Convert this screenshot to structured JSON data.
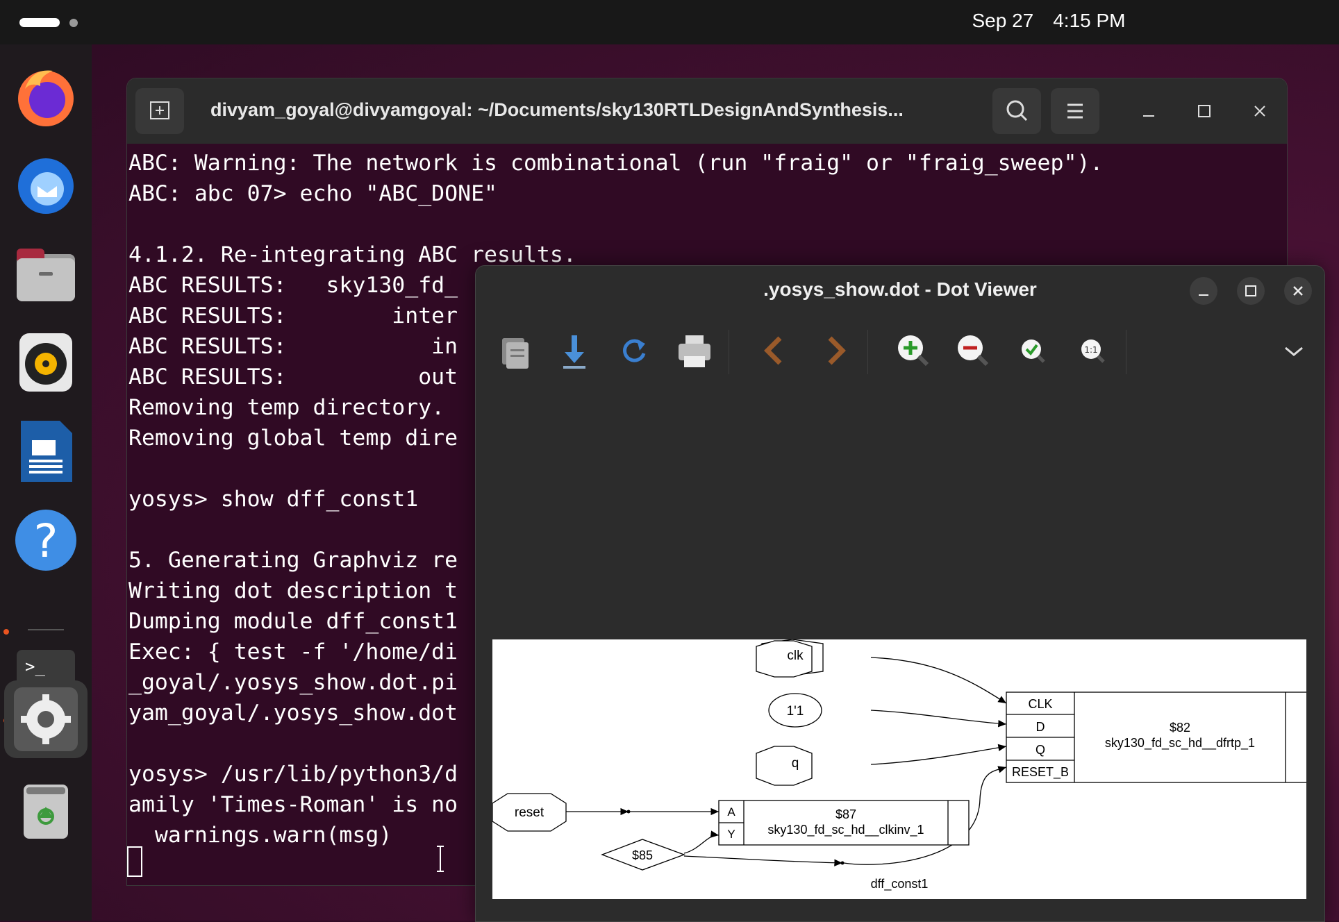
{
  "topbar": {
    "date": "Sep 27",
    "time": "4:15 PM"
  },
  "dock": {
    "items": [
      "Firefox",
      "Thunderbird",
      "Files",
      "Rhythmbox",
      "LibreOffice Writer",
      "Help",
      "Terminal",
      "Settings",
      "Trash"
    ]
  },
  "terminal": {
    "title": "divyam_goyal@divyamgoyal: ~/Documents/sky130RTLDesignAndSynthesis...",
    "lines": [
      "ABC: Warning: The network is combinational (run \"fraig\" or \"fraig_sweep\").",
      "ABC: abc 07> echo \"ABC_DONE\"",
      "",
      "4.1.2. Re-integrating ABC results.",
      "ABC RESULTS:   sky130_fd_",
      "ABC RESULTS:        inter",
      "ABC RESULTS:           in",
      "ABC RESULTS:          out",
      "Removing temp directory.",
      "Removing global temp dire",
      "",
      "yosys> show dff_const1",
      "",
      "5. Generating Graphviz re",
      "Writing dot description t",
      "Dumping module dff_const1",
      "Exec: { test -f '/home/di",
      "_goyal/.yosys_show.dot.pi",
      "yam_goyal/.yosys_show.dot",
      "",
      "yosys> /usr/lib/python3/d",
      "amily 'Times-Roman' is no",
      "  warnings.warn(msg)"
    ]
  },
  "dotviewer": {
    "title": ".yosys_show.dot - Dot Viewer",
    "graph": {
      "nodes": {
        "clk": "clk",
        "one": "1'1",
        "q": "q",
        "reset": "reset",
        "wire85": "$85",
        "dff_id": "$82",
        "dff_type": "sky130_fd_sc_hd__dfrtp_1",
        "dff_ports": [
          "CLK",
          "D",
          "Q",
          "RESET_B"
        ],
        "inv_id": "$87",
        "inv_type": "sky130_fd_sc_hd__clkinv_1",
        "inv_ports": [
          "A",
          "Y"
        ],
        "module": "dff_const1"
      }
    }
  }
}
